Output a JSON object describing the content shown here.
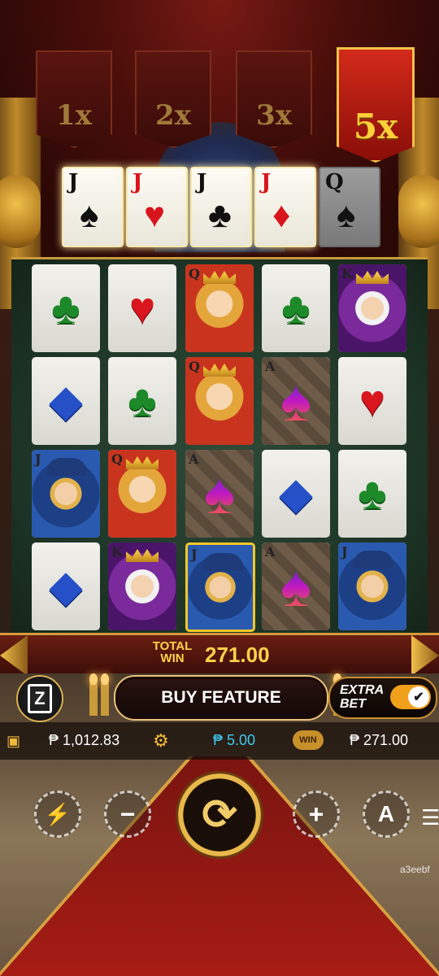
{
  "multipliers": [
    {
      "label": "1x",
      "active": false
    },
    {
      "label": "2x",
      "active": false
    },
    {
      "label": "3x",
      "active": false
    },
    {
      "label": "5x",
      "active": true
    }
  ],
  "top_cards": [
    {
      "rank": "J",
      "suit": "♠",
      "color": "black",
      "lit": true
    },
    {
      "rank": "J",
      "suit": "♥",
      "color": "red",
      "lit": true
    },
    {
      "rank": "J",
      "suit": "♣",
      "color": "black",
      "lit": true
    },
    {
      "rank": "J",
      "suit": "♦",
      "color": "red",
      "lit": true
    },
    {
      "rank": "Q",
      "suit": "♠",
      "color": "black",
      "lit": false
    }
  ],
  "reels": [
    [
      {
        "type": "club",
        "glyph": "♣"
      },
      {
        "type": "diamond",
        "glyph": "◆"
      },
      {
        "type": "jack",
        "rank": "J"
      },
      {
        "type": "diamond",
        "glyph": "◆"
      }
    ],
    [
      {
        "type": "heart",
        "glyph": "♥"
      },
      {
        "type": "club",
        "glyph": "♣"
      },
      {
        "type": "queen",
        "rank": "Q"
      },
      {
        "type": "king",
        "rank": "K"
      }
    ],
    [
      {
        "type": "queen",
        "rank": "Q"
      },
      {
        "type": "queen",
        "rank": "Q"
      },
      {
        "type": "ace",
        "rank": "A",
        "glyph": "♠"
      },
      {
        "type": "jack",
        "rank": "J",
        "gold": true
      }
    ],
    [
      {
        "type": "club",
        "glyph": "♣"
      },
      {
        "type": "ace",
        "rank": "A",
        "glyph": "♠"
      },
      {
        "type": "diamond",
        "glyph": "◆"
      },
      {
        "type": "ace",
        "rank": "A",
        "glyph": "♠"
      }
    ],
    [
      {
        "type": "king",
        "rank": "K"
      },
      {
        "type": "heart",
        "glyph": "♥"
      },
      {
        "type": "club",
        "glyph": "♣"
      },
      {
        "type": "jack",
        "rank": "J"
      }
    ]
  ],
  "win": {
    "label_line1": "TOTAL",
    "label_line2": "WIN",
    "amount": "271.00"
  },
  "controls": {
    "buy_feature": "BUY FEATURE",
    "extra_bet_line1": "EXTRA",
    "extra_bet_line2": "BET",
    "extra_bet_on": true,
    "turbo_glyph": "Z",
    "minus": "−",
    "plus": "+",
    "auto": "A",
    "menu": "☰",
    "spin_glyph": "⟳"
  },
  "info": {
    "balance": "₱ 1,012.83",
    "bet": "₱ 5.00",
    "win_badge": "WIN",
    "last_win": "₱ 271.00"
  },
  "footer_code": "a3eebf",
  "colors": {
    "gold": "#ffd24a",
    "bet_blue": "#3ec8f0",
    "active_banner": "#d32a1a"
  }
}
